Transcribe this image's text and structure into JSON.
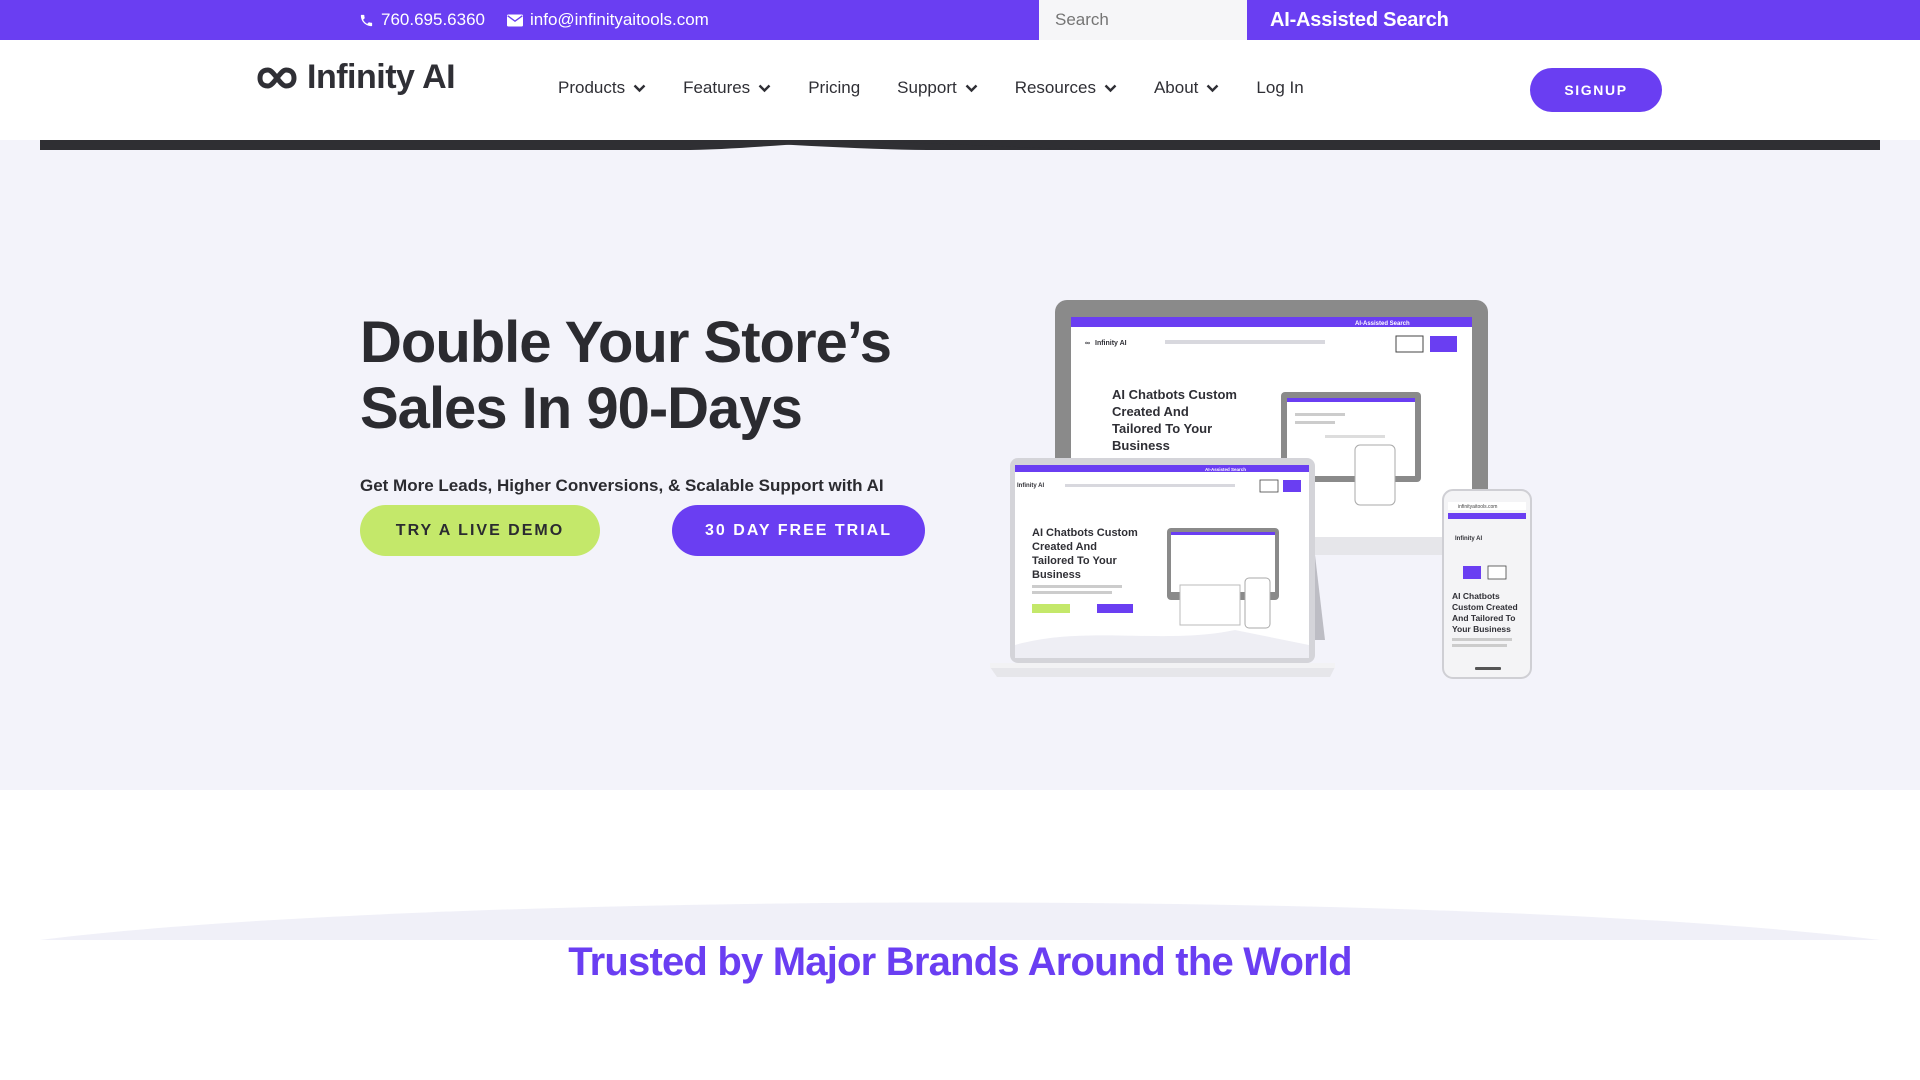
{
  "topbar": {
    "phone": "760.695.6360",
    "email": "info@infinityaitools.com",
    "search_placeholder": "Search",
    "ai_search_label": "AI-Assisted Search"
  },
  "header": {
    "logo_text": "Infinity AI",
    "nav": [
      {
        "label": "Products",
        "dropdown": true
      },
      {
        "label": "Features",
        "dropdown": true
      },
      {
        "label": "Pricing",
        "dropdown": false
      },
      {
        "label": "Support",
        "dropdown": true
      },
      {
        "label": "Resources",
        "dropdown": true
      },
      {
        "label": "About",
        "dropdown": true
      },
      {
        "label": "Log In",
        "dropdown": false
      }
    ],
    "signup_label": "SIGNUP"
  },
  "hero": {
    "title_line1": "Double Your Store’s",
    "title_line2": "Sales In 90-Days",
    "subtitle": "Get More Leads, Higher Conversions, & Scalable Support with AI",
    "demo_button": "TRY A LIVE DEMO",
    "trial_button": "30 DAY FREE TRIAL",
    "mockup": {
      "headline": "AI Chatbots Custom Created And Tailored To Your Business",
      "desktop_headline_lines": [
        "AI Chatbots Custom",
        "Created And",
        "Tailored To Your",
        "Business"
      ],
      "laptop_headline_lines": [
        "AI Chatbots Custom",
        "Created And",
        "Tailored To Your",
        "Business"
      ],
      "phone_headline_lines": [
        "AI Chatbots",
        "Custom Created",
        "And Tailored To",
        "Your Business"
      ],
      "phone_url": "infinityaitools.com",
      "logo_text": "Infinity AI",
      "ai_search": "AI-Assisted Search"
    }
  },
  "trusted": {
    "heading": "Trusted by Major Brands Around the World"
  },
  "colors": {
    "brand_purple": "#6a3ef2",
    "lime": "#c4e86a",
    "hero_bg": "#f3f3fa"
  },
  "icons": [
    "phone-icon",
    "email-icon",
    "infinity-logo-icon",
    "chevron-down-icon"
  ]
}
